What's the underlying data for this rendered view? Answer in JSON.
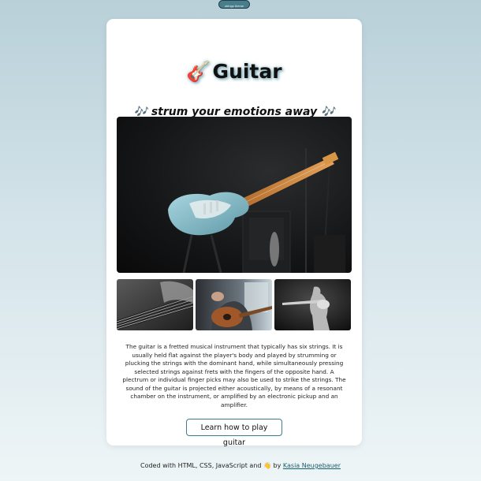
{
  "top_button": {
    "label": "strings theme"
  },
  "header": {
    "icon": "guitar-emoji",
    "icon_glyph": "🎸",
    "title": "Guitar"
  },
  "tagline": {
    "note_icon": "music-notes-emoji",
    "note_glyph": "🎶",
    "text": "strum your emotions away"
  },
  "images": {
    "hero": "electric-guitar-photo",
    "thumbnails": [
      "guitar-neck-photo",
      "acoustic-guitar-player-photo",
      "guitarist-silhouette-photo"
    ]
  },
  "description": "The guitar is a fretted musical instrument that typically has six strings. It is usually held flat against the player's body and played by strumming or plucking the strings with the dominant hand, while simultaneously pressing selected strings against frets with the fingers of the opposite hand. A plectrum or individual finger picks may also be used to strike the strings. The sound of the guitar is projected either acoustically, by means of a resonant chamber on the instrument, or amplified by an electronic pickup and an amplifier.",
  "cta": {
    "label": "Learn how to play guitar"
  },
  "footer": {
    "prefix": "Coded with HTML, CSS, JavaScript and",
    "wave_icon": "waving-hand-emoji",
    "wave_glyph": "👋",
    "by": "by",
    "author": "Kasia Neugebauer"
  },
  "colors": {
    "accent": "#3f7d8e",
    "background_top": "#b9d0d9",
    "background_bottom": "#eef5f7",
    "card": "#ffffff"
  }
}
